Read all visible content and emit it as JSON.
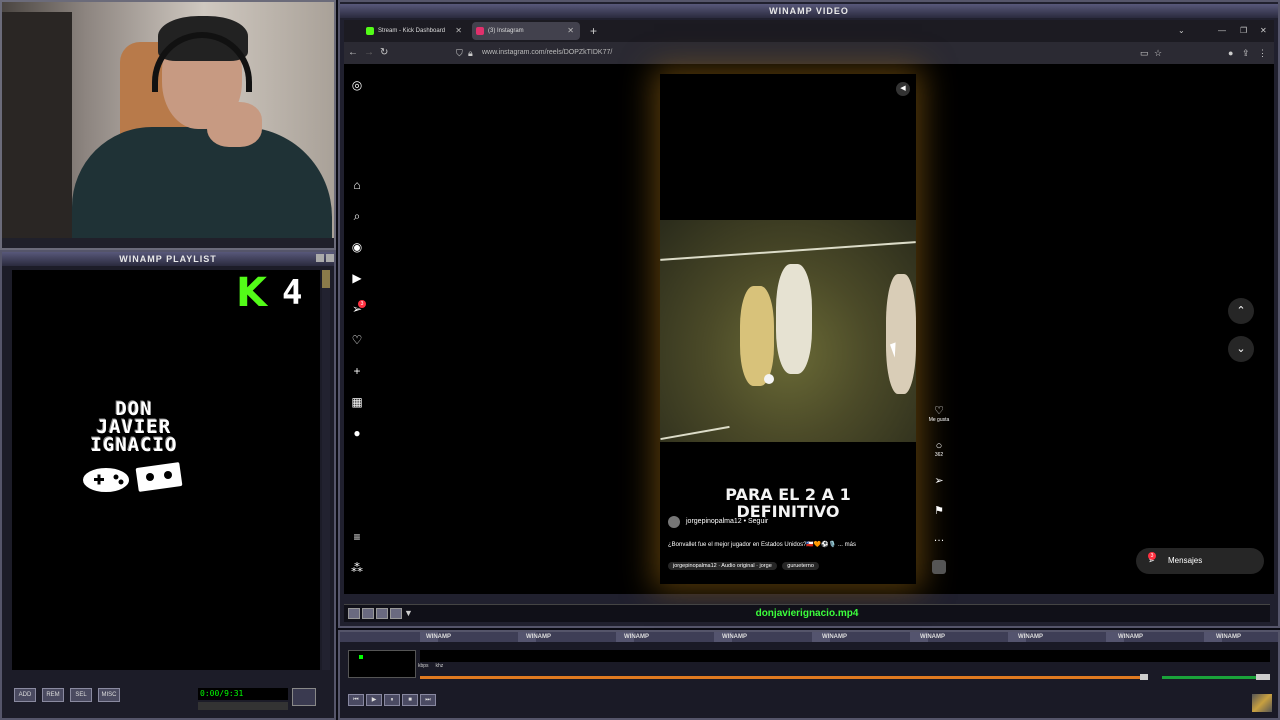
{
  "playlist": {
    "title": "WINAMP PLAYLIST",
    "kick_count": "4",
    "brand_lines": [
      "DON",
      "JAVIER",
      "IGNACIO"
    ],
    "buttons": [
      "ADD",
      "REM",
      "SEL",
      "MISC"
    ],
    "time": "0:00/9:31"
  },
  "video": {
    "title": "WINAMP VIDEO",
    "filename": "donjavierignacio.mp4"
  },
  "browser": {
    "tabs": [
      {
        "label": "Stream - Kick Dashboard",
        "icon": "kick-icon",
        "color": "#53fc18",
        "active": false
      },
      {
        "label": "(3) Instagram",
        "icon": "instagram-icon",
        "color": "#e1306c",
        "active": true
      }
    ],
    "url": "www.instagram.com/reels/DOPZkTIDK77/"
  },
  "instagram": {
    "nav_badge": "3",
    "overlay_text": [
      "PARA EL 2 A 1",
      "DEFINITIVO"
    ],
    "author": "jorgepinopalma12",
    "follow": "Seguir",
    "caption": "¿Bonvallet fue el mejor jugador en Estados Unidos?🇨🇱🧡⚽🎙️ ... más",
    "audio": "jorgepinopalma12 · Audio original · jorge",
    "tagged": "gurueterno",
    "like_label": "Me gusta",
    "comment_count": "362",
    "messages_label": "Mensajes",
    "messages_badge": "3"
  },
  "winamp": {
    "stripe_label": "WINAMP",
    "kbps": "kbps",
    "khz": "khz",
    "seek_progress": 0.93,
    "volume": 0.85,
    "colors": {
      "accent": "#3cff3c",
      "seek": "#e07a20",
      "kick": "#53fc18"
    }
  }
}
